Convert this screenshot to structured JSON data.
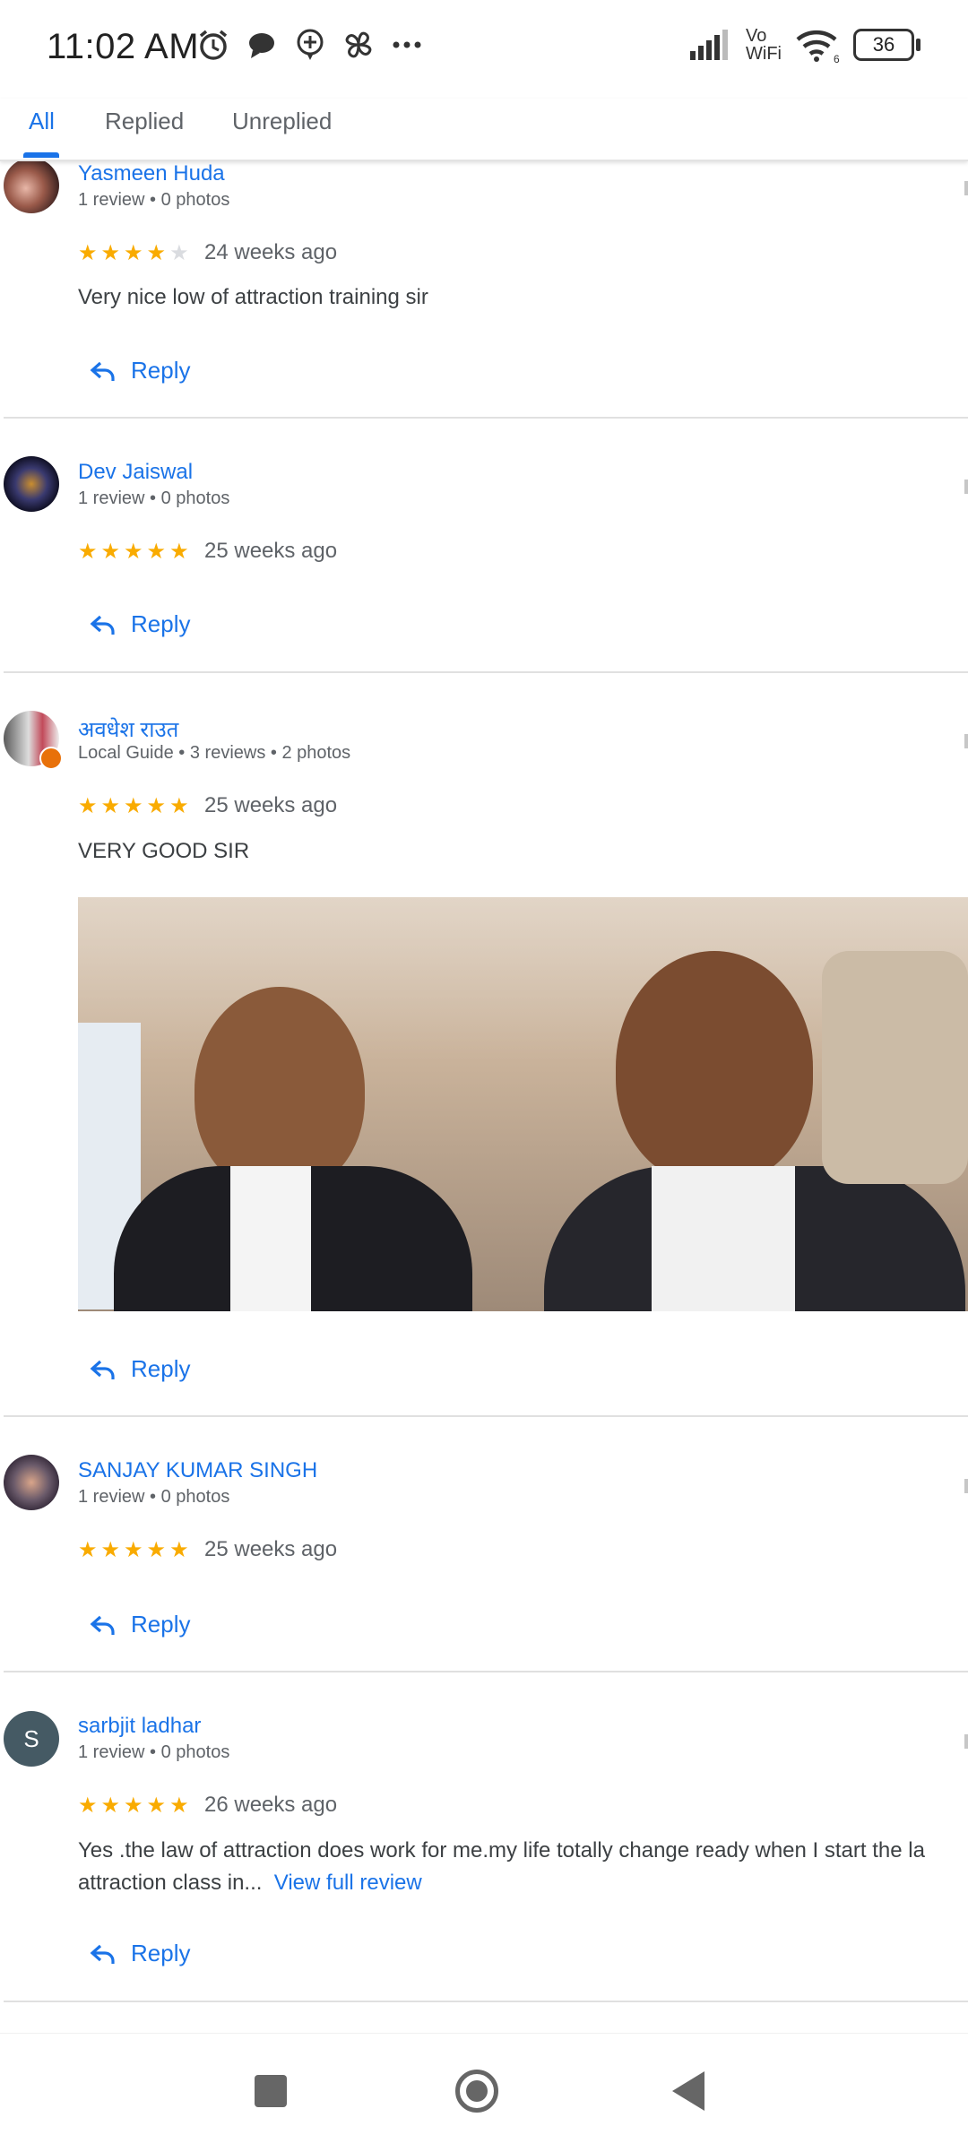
{
  "status": {
    "time": "11:02 AM",
    "network_label_top": "Vo",
    "network_label_bottom": "WiFi",
    "wifi_badge": "6",
    "battery": "36"
  },
  "tabs": [
    {
      "label": "All",
      "active": true
    },
    {
      "label": "Replied",
      "active": false
    },
    {
      "label": "Unreplied",
      "active": false
    }
  ],
  "reply_label": "Reply",
  "reviews": [
    {
      "name": "Yasmeen Huda",
      "meta": "1 review • 0 photos",
      "rating": 4,
      "time": "24 weeks ago",
      "text": "Very nice low of attraction training sir"
    },
    {
      "name": "Dev Jaiswal",
      "meta": "1 review • 0 photos",
      "rating": 5,
      "time": "25 weeks ago",
      "text": ""
    },
    {
      "name": "अवधेश राउत",
      "meta": "Local Guide • 3 reviews • 2 photos",
      "rating": 5,
      "time": "25 weeks ago",
      "text": "VERY GOOD SIR"
    },
    {
      "name": "SANJAY KUMAR SINGH",
      "meta": "1 review • 0 photos",
      "rating": 5,
      "time": "25 weeks ago",
      "text": ""
    },
    {
      "name": "sarbjit ladhar",
      "avatar_initial": "S",
      "meta": "1 review • 0 photos",
      "rating": 5,
      "time": "26 weeks ago",
      "text_line1": "Yes .the law of attraction does work for me.my life totally change ready when I start the la",
      "text_line2": "attraction class in...",
      "view_full": "View full review"
    }
  ],
  "icons": [
    "alarm-icon",
    "chat-icon",
    "add-location-icon",
    "fan-icon",
    "more-dots-icon",
    "signal-icon",
    "wifi-icon",
    "battery-icon",
    "reply-icon",
    "nav-recent-icon",
    "nav-home-icon",
    "nav-back-icon"
  ],
  "colors": {
    "accent": "#1a73e8",
    "star": "#f9ab00",
    "divider": "#e0e0e0"
  }
}
